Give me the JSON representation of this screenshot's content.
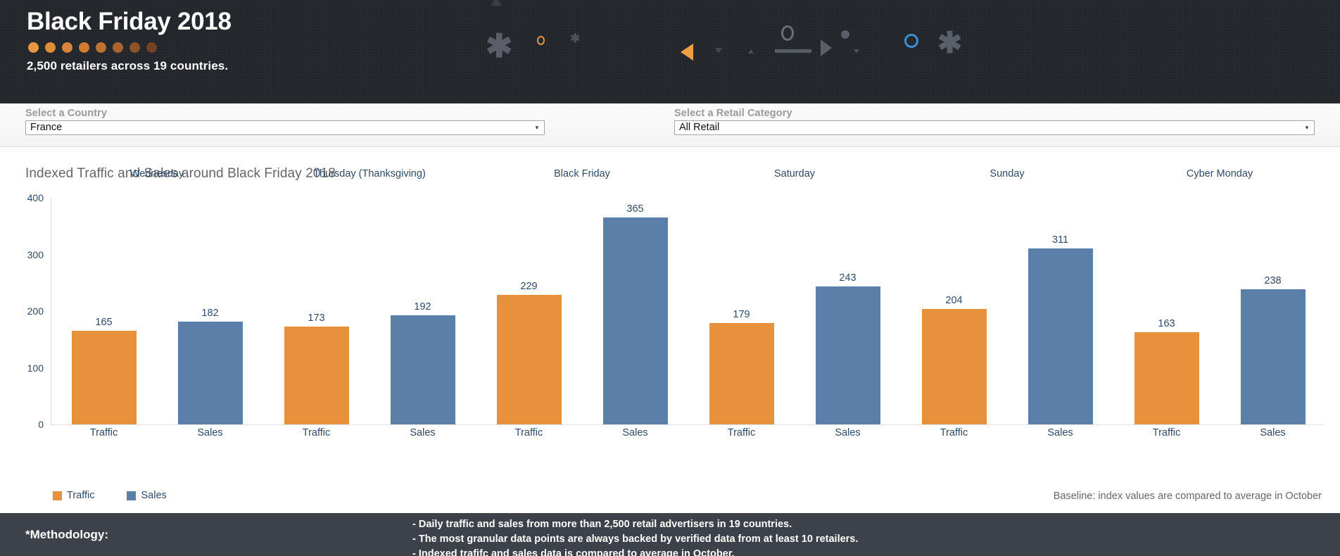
{
  "header": {
    "title": "Black Friday 2018",
    "subtitle": "2,500 retailers across 19 countries.",
    "dot_colors": [
      "#e8973f",
      "#e08c3b",
      "#d98438",
      "#d07c35",
      "#be7133",
      "#a9632e",
      "#8c5228",
      "#734324"
    ],
    "accent_orange": "#e8913c",
    "accent_blue": "#4a90d9",
    "background": "#23262b"
  },
  "filters": {
    "country": {
      "label": "Select a Country",
      "value": "France",
      "caret": "chevron-down-icon"
    },
    "category": {
      "label": "Select a Retail Category",
      "value": "All Retail",
      "caret": "chevron-down-icon"
    }
  },
  "chart_data": {
    "type": "bar",
    "title": "Indexed Traffic and Sales around Black Friday 2018",
    "xlabel": "",
    "ylabel": "",
    "ylim": [
      0,
      400
    ],
    "yticks": [
      400,
      300,
      200,
      100,
      0
    ],
    "grid": false,
    "legend_position": "bottom-left",
    "categories": [
      "Wednesday",
      "Thursday (Thanksgiving)",
      "Black Friday",
      "Saturday",
      "Sunday",
      "Cyber Monday"
    ],
    "subcategories": [
      "Traffic",
      "Sales"
    ],
    "series": [
      {
        "name": "Traffic",
        "color": "#e8913c",
        "values": [
          165,
          173,
          229,
          179,
          204,
          163
        ]
      },
      {
        "name": "Sales",
        "color": "#5b7fa8",
        "values": [
          182,
          192,
          365,
          243,
          311,
          238
        ]
      }
    ],
    "annotation": "Baseline: index values are compared to average in October"
  },
  "footer": {
    "label": "*Methodology:",
    "lines": [
      "- Daily traffic and sales from more than 2,500 retail advertisers in 19 countries.",
      "- The most granular data points are always backed by verified data from at least 10 retailers.",
      "- Indexed trafifc and sales data is compared to average in October."
    ]
  }
}
